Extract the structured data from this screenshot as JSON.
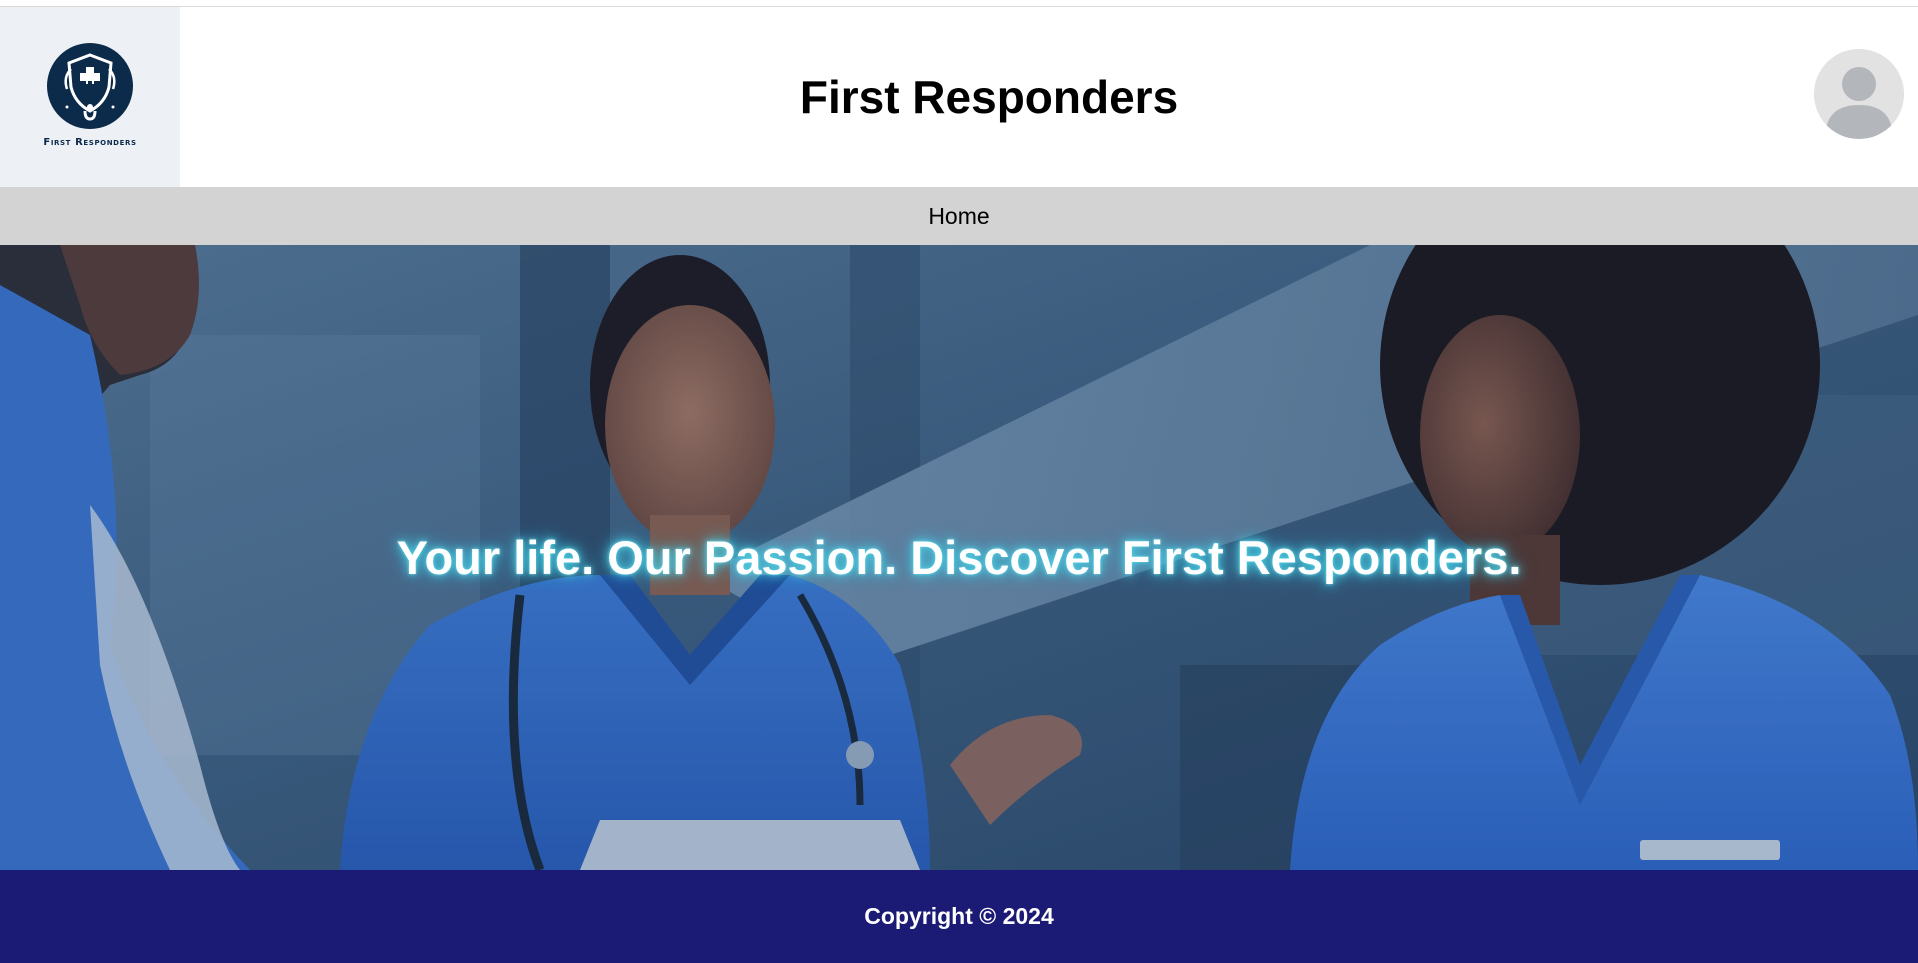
{
  "header": {
    "logo_text": "First Responders",
    "title": "First Responders"
  },
  "nav": {
    "items": [
      {
        "label": "Home"
      }
    ]
  },
  "hero": {
    "tagline": "Your life. Our Passion. Discover First Responders."
  },
  "footer": {
    "copyright": "Copyright © 2024"
  },
  "colors": {
    "nav_bg": "#d3d3d3",
    "footer_bg": "#1b1a74",
    "logo_navy": "#0c2a4a",
    "tagline_glow": "#4fd6e8"
  },
  "icons": {
    "logo": "medical-shield-emblem",
    "avatar": "user-avatar-icon"
  }
}
